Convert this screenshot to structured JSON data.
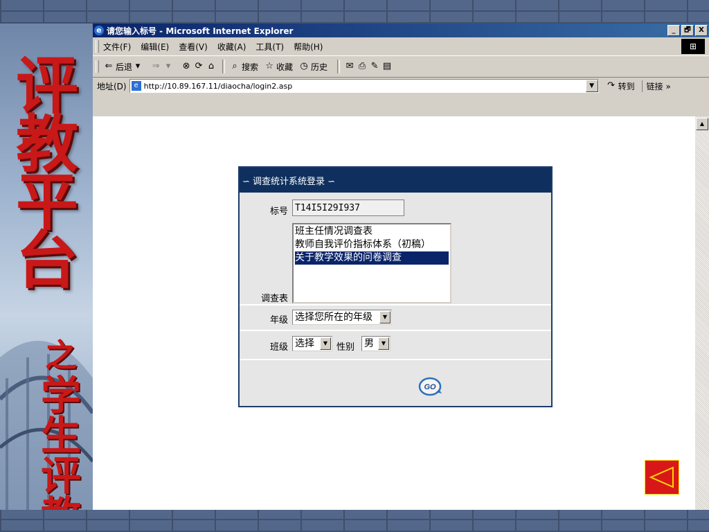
{
  "window": {
    "title": "请您输入标号 - Microsoft Internet Explorer",
    "buttons": [
      "_",
      "🗗",
      "X"
    ]
  },
  "menu": [
    "文件(F)",
    "编辑(E)",
    "查看(V)",
    "收藏(A)",
    "工具(T)",
    "帮助(H)"
  ],
  "toolbar": {
    "back": "后退",
    "search": "搜索",
    "favorites": "收藏",
    "history": "历史"
  },
  "address": {
    "label": "地址(D)",
    "url": "http://10.89.167.11/diaocha/login2.asp",
    "go": "转到",
    "links": "链接 »"
  },
  "banner": {
    "title_chars": [
      "评",
      "教",
      "平",
      "台"
    ],
    "subtitle_chars": [
      "之",
      "学",
      "生",
      "评",
      "教"
    ]
  },
  "login": {
    "header": "∽ 调查统计系统登录 ∽",
    "id_label": "标号",
    "id_value": "T14I5I29I937",
    "survey_label": "调查表",
    "surveys": [
      "班主任情况调查表",
      "教师自我评价指标体系（初稿）",
      "关于教学效果的问卷调查"
    ],
    "selected_survey": 2,
    "grade_label": "年级",
    "grade_value": "选择您所在的年级",
    "class_label": "班级",
    "class_value": "选择",
    "gender_label": "性别",
    "gender_value": "男",
    "go_label": "GO"
  },
  "colors": {
    "title_red": "#c81818",
    "login_header": "#0f305e",
    "selection": "#0a246a",
    "prev_button": "#d81818"
  }
}
